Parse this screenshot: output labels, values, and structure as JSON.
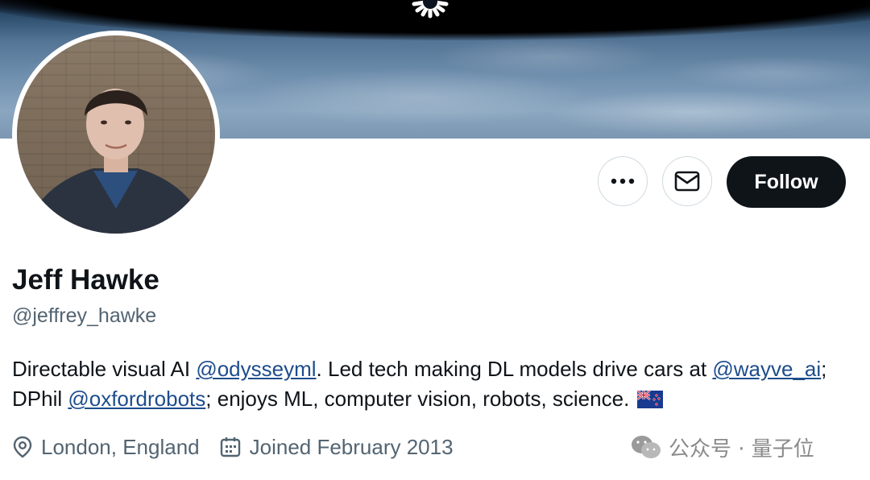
{
  "profile": {
    "name": "Jeff Hawke",
    "handle": "@jeffrey_hawke",
    "bio": {
      "part1": "Directable visual AI ",
      "mention1": "@odysseyml",
      "part2": ". Led tech making DL models drive cars at ",
      "mention2": "@wayve_ai",
      "part3": "; DPhil ",
      "mention3": "@oxfordrobots",
      "part4": "; enjoys ML, computer vision, robots, science. "
    },
    "location": "London, England",
    "joined": "Joined February 2013"
  },
  "actions": {
    "follow_label": "Follow"
  },
  "icons": {
    "more": "more-horizontal-icon",
    "message": "envelope-icon",
    "location": "location-pin-icon",
    "calendar": "calendar-icon",
    "flag": "new-zealand-flag-icon"
  },
  "watermark": {
    "text": "公众号 · 量子位"
  },
  "colors": {
    "follow_bg": "#0f1419",
    "mention": "#1d4d8c",
    "secondary_text": "#536471"
  }
}
